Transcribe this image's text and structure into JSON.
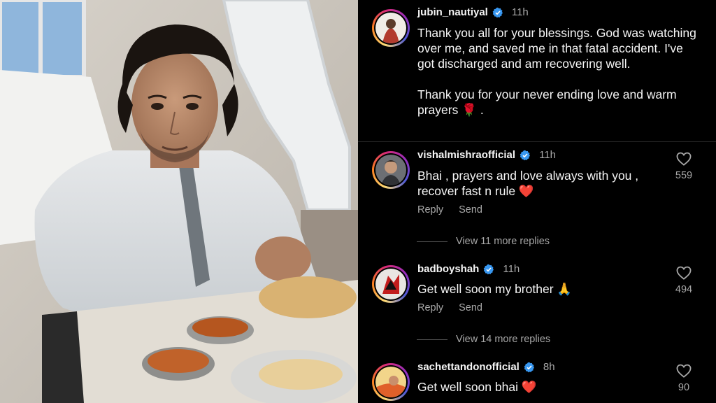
{
  "post": {
    "author": "jubin_nautiyal",
    "time": "11h",
    "caption_p1": "Thank you all for your blessings. God was watching over me, and saved me in that fatal accident. I've got discharged and am recovering well.",
    "caption_p2": "Thank you for your never ending love and warm prayers 🌹 ."
  },
  "comments": [
    {
      "username": "vishalmishraofficial",
      "time": "11h",
      "text": "Bhai , prayers and love always with you , recover fast n rule ❤️",
      "likes": "559",
      "reply_label": "Reply",
      "send_label": "Send",
      "view_more": "View 11 more replies"
    },
    {
      "username": "badboyshah",
      "time": "11h",
      "text": "Get well soon my brother 🙏",
      "likes": "494",
      "reply_label": "Reply",
      "send_label": "Send",
      "view_more": "View 14 more replies"
    },
    {
      "username": "sachettandonofficial",
      "time": "8h",
      "text": "Get well soon bhai ❤️",
      "likes": "90"
    }
  ],
  "colors": {
    "background": "#000000",
    "verified_badge": "#3897f0",
    "muted_text": "#a8a8a8",
    "heart_red": "#e0245e"
  },
  "icons": {
    "verified": "verified-badge-icon",
    "like": "heart-outline-icon"
  }
}
